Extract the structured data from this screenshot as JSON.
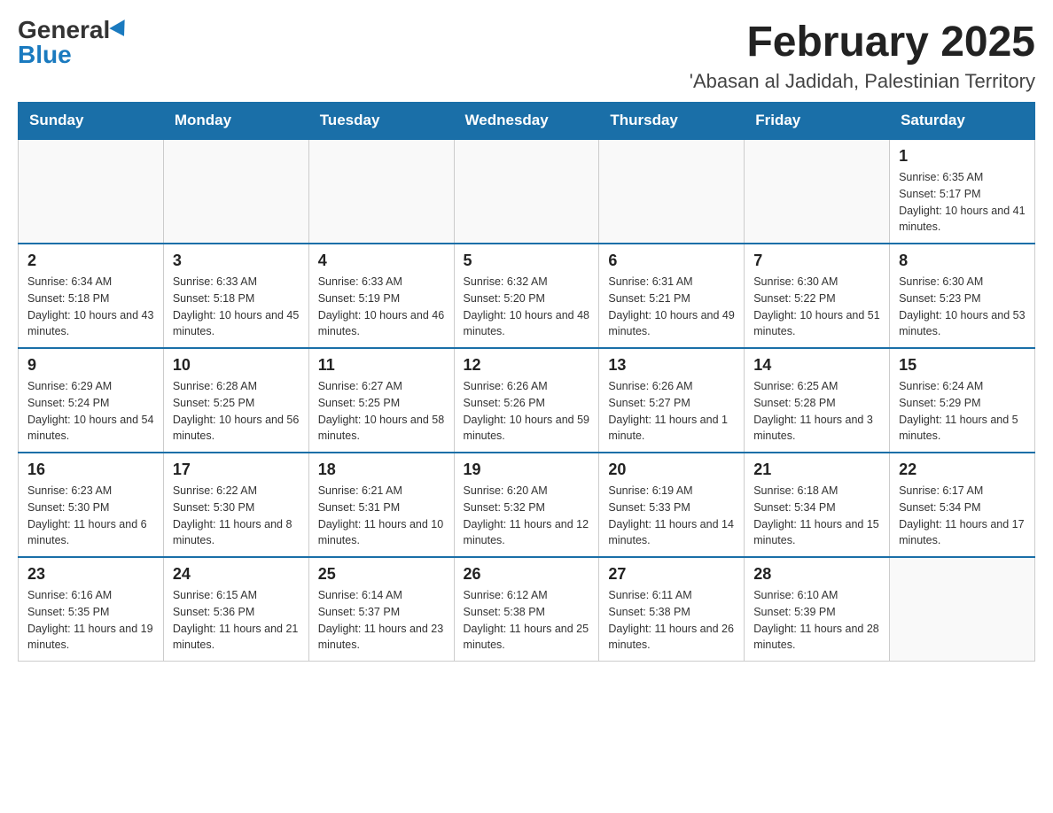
{
  "header": {
    "logo_general": "General",
    "logo_blue": "Blue",
    "month_title": "February 2025",
    "location": "'Abasan al Jadidah, Palestinian Territory"
  },
  "days_of_week": [
    "Sunday",
    "Monday",
    "Tuesday",
    "Wednesday",
    "Thursday",
    "Friday",
    "Saturday"
  ],
  "weeks": [
    [
      {
        "day": "",
        "info": ""
      },
      {
        "day": "",
        "info": ""
      },
      {
        "day": "",
        "info": ""
      },
      {
        "day": "",
        "info": ""
      },
      {
        "day": "",
        "info": ""
      },
      {
        "day": "",
        "info": ""
      },
      {
        "day": "1",
        "info": "Sunrise: 6:35 AM\nSunset: 5:17 PM\nDaylight: 10 hours and 41 minutes."
      }
    ],
    [
      {
        "day": "2",
        "info": "Sunrise: 6:34 AM\nSunset: 5:18 PM\nDaylight: 10 hours and 43 minutes."
      },
      {
        "day": "3",
        "info": "Sunrise: 6:33 AM\nSunset: 5:18 PM\nDaylight: 10 hours and 45 minutes."
      },
      {
        "day": "4",
        "info": "Sunrise: 6:33 AM\nSunset: 5:19 PM\nDaylight: 10 hours and 46 minutes."
      },
      {
        "day": "5",
        "info": "Sunrise: 6:32 AM\nSunset: 5:20 PM\nDaylight: 10 hours and 48 minutes."
      },
      {
        "day": "6",
        "info": "Sunrise: 6:31 AM\nSunset: 5:21 PM\nDaylight: 10 hours and 49 minutes."
      },
      {
        "day": "7",
        "info": "Sunrise: 6:30 AM\nSunset: 5:22 PM\nDaylight: 10 hours and 51 minutes."
      },
      {
        "day": "8",
        "info": "Sunrise: 6:30 AM\nSunset: 5:23 PM\nDaylight: 10 hours and 53 minutes."
      }
    ],
    [
      {
        "day": "9",
        "info": "Sunrise: 6:29 AM\nSunset: 5:24 PM\nDaylight: 10 hours and 54 minutes."
      },
      {
        "day": "10",
        "info": "Sunrise: 6:28 AM\nSunset: 5:25 PM\nDaylight: 10 hours and 56 minutes."
      },
      {
        "day": "11",
        "info": "Sunrise: 6:27 AM\nSunset: 5:25 PM\nDaylight: 10 hours and 58 minutes."
      },
      {
        "day": "12",
        "info": "Sunrise: 6:26 AM\nSunset: 5:26 PM\nDaylight: 10 hours and 59 minutes."
      },
      {
        "day": "13",
        "info": "Sunrise: 6:26 AM\nSunset: 5:27 PM\nDaylight: 11 hours and 1 minute."
      },
      {
        "day": "14",
        "info": "Sunrise: 6:25 AM\nSunset: 5:28 PM\nDaylight: 11 hours and 3 minutes."
      },
      {
        "day": "15",
        "info": "Sunrise: 6:24 AM\nSunset: 5:29 PM\nDaylight: 11 hours and 5 minutes."
      }
    ],
    [
      {
        "day": "16",
        "info": "Sunrise: 6:23 AM\nSunset: 5:30 PM\nDaylight: 11 hours and 6 minutes."
      },
      {
        "day": "17",
        "info": "Sunrise: 6:22 AM\nSunset: 5:30 PM\nDaylight: 11 hours and 8 minutes."
      },
      {
        "day": "18",
        "info": "Sunrise: 6:21 AM\nSunset: 5:31 PM\nDaylight: 11 hours and 10 minutes."
      },
      {
        "day": "19",
        "info": "Sunrise: 6:20 AM\nSunset: 5:32 PM\nDaylight: 11 hours and 12 minutes."
      },
      {
        "day": "20",
        "info": "Sunrise: 6:19 AM\nSunset: 5:33 PM\nDaylight: 11 hours and 14 minutes."
      },
      {
        "day": "21",
        "info": "Sunrise: 6:18 AM\nSunset: 5:34 PM\nDaylight: 11 hours and 15 minutes."
      },
      {
        "day": "22",
        "info": "Sunrise: 6:17 AM\nSunset: 5:34 PM\nDaylight: 11 hours and 17 minutes."
      }
    ],
    [
      {
        "day": "23",
        "info": "Sunrise: 6:16 AM\nSunset: 5:35 PM\nDaylight: 11 hours and 19 minutes."
      },
      {
        "day": "24",
        "info": "Sunrise: 6:15 AM\nSunset: 5:36 PM\nDaylight: 11 hours and 21 minutes."
      },
      {
        "day": "25",
        "info": "Sunrise: 6:14 AM\nSunset: 5:37 PM\nDaylight: 11 hours and 23 minutes."
      },
      {
        "day": "26",
        "info": "Sunrise: 6:12 AM\nSunset: 5:38 PM\nDaylight: 11 hours and 25 minutes."
      },
      {
        "day": "27",
        "info": "Sunrise: 6:11 AM\nSunset: 5:38 PM\nDaylight: 11 hours and 26 minutes."
      },
      {
        "day": "28",
        "info": "Sunrise: 6:10 AM\nSunset: 5:39 PM\nDaylight: 11 hours and 28 minutes."
      },
      {
        "day": "",
        "info": ""
      }
    ]
  ]
}
